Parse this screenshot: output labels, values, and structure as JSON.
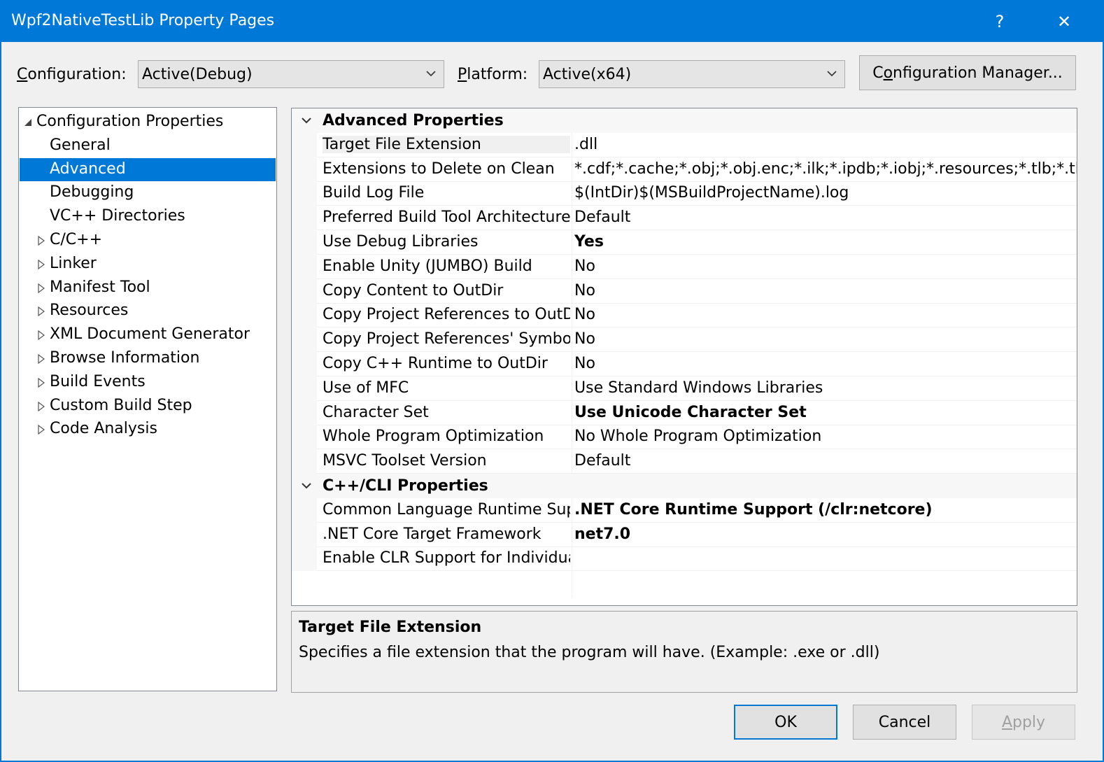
{
  "window": {
    "title": "Wpf2NativeTestLib Property Pages",
    "help_glyph": "?",
    "close_glyph": "✕"
  },
  "toolbar": {
    "configuration_label_accel": "C",
    "configuration_label_rest": "onfiguration:",
    "configuration_value": "Active(Debug)",
    "platform_label_accel": "P",
    "platform_label_rest": "latform:",
    "platform_value": "Active(x64)",
    "config_manager_pre": "C",
    "config_manager_accel": "o",
    "config_manager_rest": "nfiguration Manager..."
  },
  "tree": {
    "items": [
      {
        "label": "Configuration Properties",
        "expanded": true,
        "level": 0
      },
      {
        "label": "General",
        "level": 1
      },
      {
        "label": "Advanced",
        "level": 1,
        "selected": true
      },
      {
        "label": "Debugging",
        "level": 1
      },
      {
        "label": "VC++ Directories",
        "level": 1
      },
      {
        "label": "C/C++",
        "level": 1,
        "collapsed": true
      },
      {
        "label": "Linker",
        "level": 1,
        "collapsed": true
      },
      {
        "label": "Manifest Tool",
        "level": 1,
        "collapsed": true
      },
      {
        "label": "Resources",
        "level": 1,
        "collapsed": true
      },
      {
        "label": "XML Document Generator",
        "level": 1,
        "collapsed": true
      },
      {
        "label": "Browse Information",
        "level": 1,
        "collapsed": true
      },
      {
        "label": "Build Events",
        "level": 1,
        "collapsed": true
      },
      {
        "label": "Custom Build Step",
        "level": 1,
        "collapsed": true
      },
      {
        "label": "Code Analysis",
        "level": 1,
        "collapsed": true
      }
    ]
  },
  "grid": {
    "categories": [
      {
        "label": "Advanced Properties",
        "properties": [
          {
            "name": "Target File Extension",
            "value": ".dll",
            "bold": false
          },
          {
            "name": "Extensions to Delete on Clean",
            "value": "*.cdf;*.cache;*.obj;*.obj.enc;*.ilk;*.ipdb;*.iobj;*.resources;*.tlb;*.tli;*.tlh;*",
            "bold": false
          },
          {
            "name": "Build Log File",
            "value": "$(IntDir)$(MSBuildProjectName).log",
            "bold": false
          },
          {
            "name": "Preferred Build Tool Architecture",
            "value": "Default",
            "bold": false
          },
          {
            "name": "Use Debug Libraries",
            "value": "Yes",
            "bold": true
          },
          {
            "name": "Enable Unity (JUMBO) Build",
            "value": "No",
            "bold": false
          },
          {
            "name": "Copy Content to OutDir",
            "value": "No",
            "bold": false
          },
          {
            "name": "Copy Project References to OutDi",
            "value": "No",
            "bold": false
          },
          {
            "name": "Copy Project References' Symbols",
            "value": "No",
            "bold": false
          },
          {
            "name": "Copy C++ Runtime to OutDir",
            "value": "No",
            "bold": false
          },
          {
            "name": "Use of MFC",
            "value": "Use Standard Windows Libraries",
            "bold": false
          },
          {
            "name": "Character Set",
            "value": "Use Unicode Character Set",
            "bold": true
          },
          {
            "name": "Whole Program Optimization",
            "value": "No Whole Program Optimization",
            "bold": false
          },
          {
            "name": "MSVC Toolset Version",
            "value": "Default",
            "bold": false
          }
        ]
      },
      {
        "label": "C++/CLI Properties",
        "properties": [
          {
            "name": "Common Language Runtime Sup",
            "value": ".NET Core Runtime Support (/clr:netcore)",
            "bold": true
          },
          {
            "name": ".NET Core Target Framework",
            "value": "net7.0",
            "bold": true
          },
          {
            "name": "Enable CLR Support for Individual",
            "value": "",
            "bold": false
          }
        ]
      }
    ]
  },
  "description": {
    "title": "Target File Extension",
    "text": "Specifies a file extension that the program will have. (Example: .exe or .dll)"
  },
  "buttons": {
    "ok": "OK",
    "cancel": "Cancel",
    "apply_accel": "A",
    "apply_rest": "pply"
  },
  "colors": {
    "accent": "#0078d7",
    "dialog_bg": "#f0f0f0",
    "disabled_text": "#a0a0a0"
  }
}
